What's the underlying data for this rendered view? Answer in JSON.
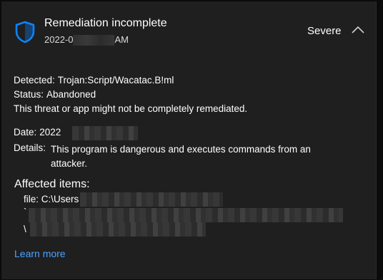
{
  "colors": {
    "background": "#1f1f1f",
    "accent": "#4aa3ff",
    "shield": "#0a84ff",
    "text": "#ffffff"
  },
  "header": {
    "icon": "shield-icon",
    "title": "Remediation incomplete",
    "time_prefix": "2022-0",
    "time_suffix": "AM",
    "severity": "Severe",
    "collapse_icon": "chevron-up-icon"
  },
  "details": {
    "detected_label": "Detected:",
    "detected_value": "Trojan:Script/Wacatac.B!ml",
    "status_label": "Status:",
    "status_value": "Abandoned",
    "note": "This threat or app might not be completely remediated.",
    "date_label": "Date:",
    "date_value": "2022",
    "details_label": "Details:",
    "details_value": "This program is dangerous and executes commands from an attacker."
  },
  "affected": {
    "title": "Affected items:",
    "file_line": "file: C:\\Users",
    "line2_prefix": "`",
    "line3_prefix": "\\"
  },
  "footer": {
    "learn_more": "Learn more"
  }
}
